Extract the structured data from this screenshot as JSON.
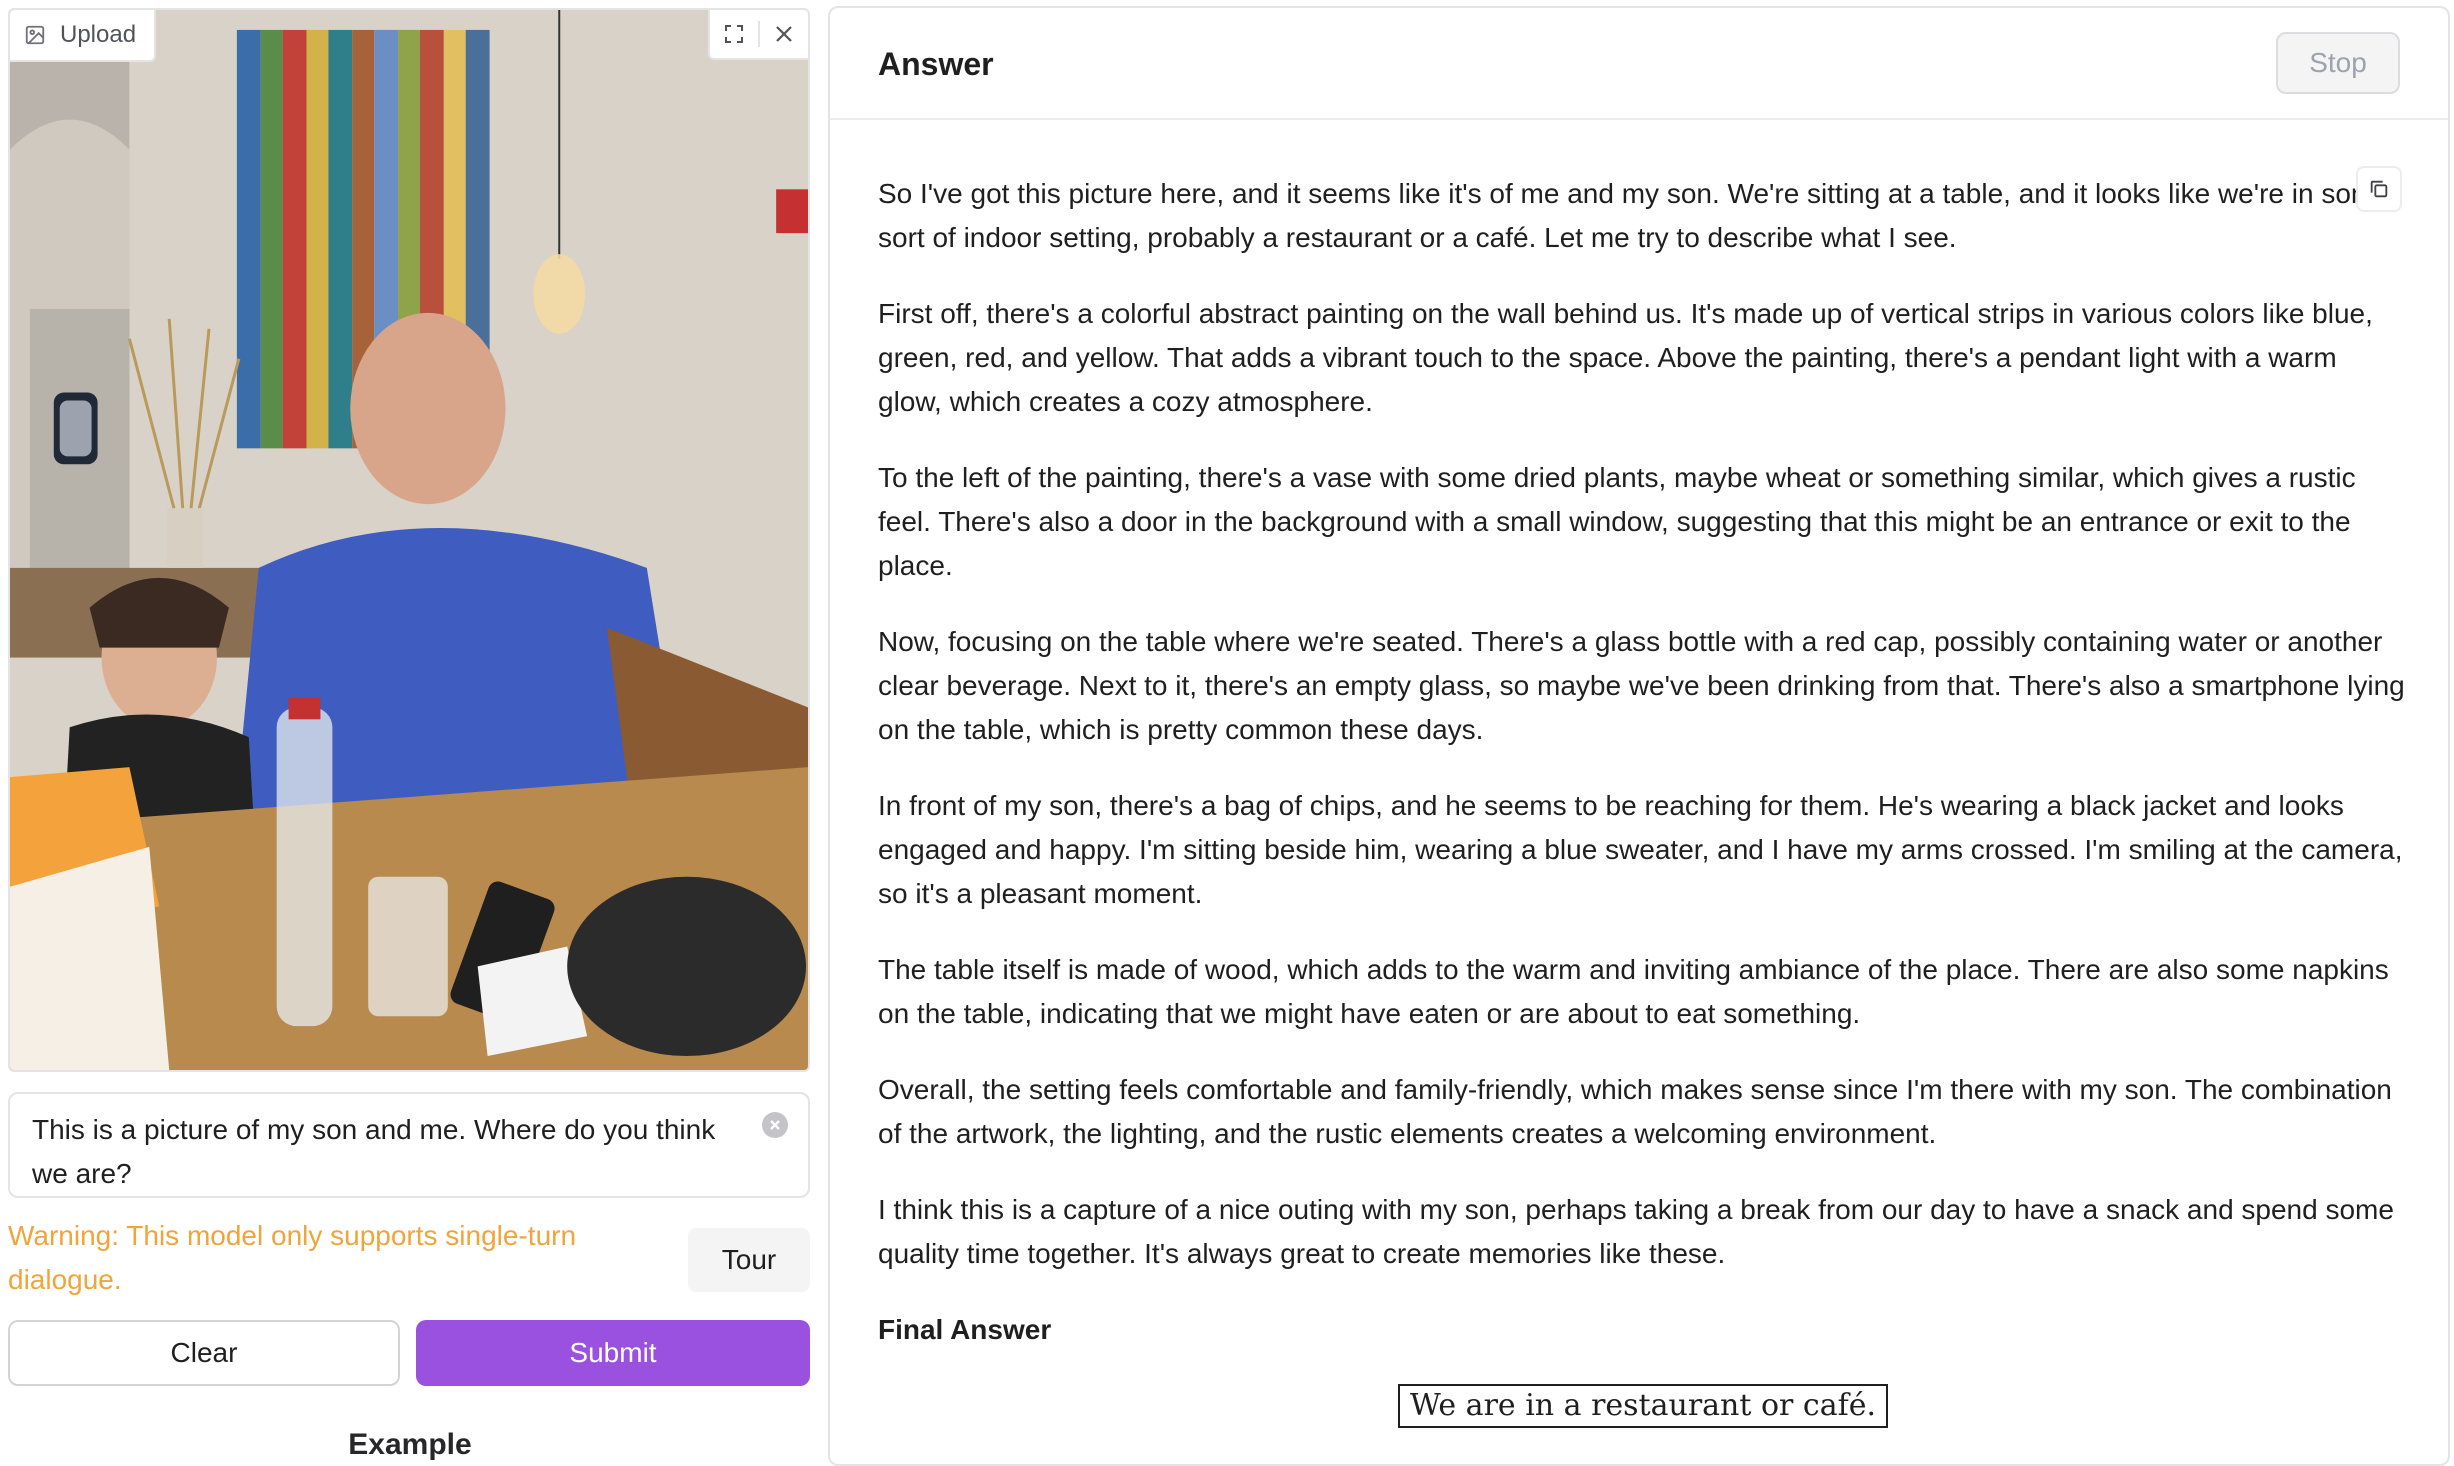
{
  "image_panel": {
    "upload_label": "Upload",
    "photo_description_icon": "image-icon",
    "tools": [
      "fullscreen-icon",
      "close-icon"
    ]
  },
  "prompt": {
    "value": "This is a picture of my son and me. Where do you think we are?"
  },
  "warning": "Warning: This model only supports single-turn dialogue.",
  "buttons": {
    "tour": "Tour",
    "clear": "Clear",
    "submit": "Submit",
    "stop": "Stop"
  },
  "example_label": "Example",
  "answer": {
    "title": "Answer",
    "paragraphs": [
      "So I've got this picture here, and it seems like it's of me and my son. We're sitting at a table, and it looks like we're in some sort of indoor setting, probably a restaurant or a café. Let me try to describe what I see.",
      "First off, there's a colorful abstract painting on the wall behind us. It's made up of vertical strips in various colors like blue, green, red, and yellow. That adds a vibrant touch to the space. Above the painting, there's a pendant light with a warm glow, which creates a cozy atmosphere.",
      "To the left of the painting, there's a vase with some dried plants, maybe wheat or something similar, which gives a rustic feel. There's also a door in the background with a small window, suggesting that this might be an entrance or exit to the place.",
      "Now, focusing on the table where we're seated. There's a glass bottle with a red cap, possibly containing water or another clear beverage. Next to it, there's an empty glass, so maybe we've been drinking from that. There's also a smartphone lying on the table, which is pretty common these days.",
      "In front of my son, there's a bag of chips, and he seems to be reaching for them. He's wearing a black jacket and looks engaged and happy. I'm sitting beside him, wearing a blue sweater, and I have my arms crossed. I'm smiling at the camera, so it's a pleasant moment.",
      "The table itself is made of wood, which adds to the warm and inviting ambiance of the place. There are also some napkins on the table, indicating that we might have eaten or are about to eat something.",
      "Overall, the setting feels comfortable and family-friendly, which makes sense since I'm there with my son. The combination of the artwork, the lighting, and the rustic elements creates a welcoming environment.",
      "I think this is a capture of a nice outing with my son, perhaps taking a break from our day to have a snack and spend some quality time together. It's always great to create memories like these."
    ],
    "final_heading": "Final Answer",
    "final_answer": "We are in a restaurant or café."
  },
  "colors": {
    "accent": "#9b51e0",
    "warning": "#f0a43a"
  }
}
